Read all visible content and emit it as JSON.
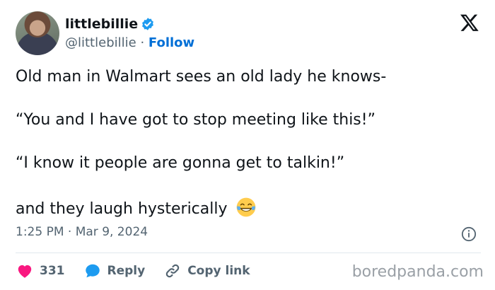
{
  "author": {
    "display_name": "littlebillie",
    "handle": "@littlebillie",
    "separator": "·",
    "follow_label": "Follow"
  },
  "tweet": {
    "lines": [
      "Old man in Walmart sees an old lady he knows-",
      "“You and I have got to stop meeting like this!”",
      "“I know it people are gonna get to talkin!”",
      "and they laugh hysterically"
    ],
    "emoji": "😂",
    "timestamp": "1:25 PM · Mar 9, 2024"
  },
  "actions": {
    "likes_count": "331",
    "reply_label": "Reply",
    "copy_link_label": "Copy link"
  },
  "watermark": "boredpanda.com",
  "colors": {
    "accent": "#006fd6",
    "verified": "#1d9bf0",
    "like": "#f91880",
    "reply": "#1d9bf0",
    "muted": "#536471"
  },
  "icons": [
    "verified-badge-icon",
    "x-logo-icon",
    "info-icon",
    "heart-icon",
    "reply-bubble-icon",
    "link-icon",
    "laughing-tears-emoji-icon"
  ]
}
